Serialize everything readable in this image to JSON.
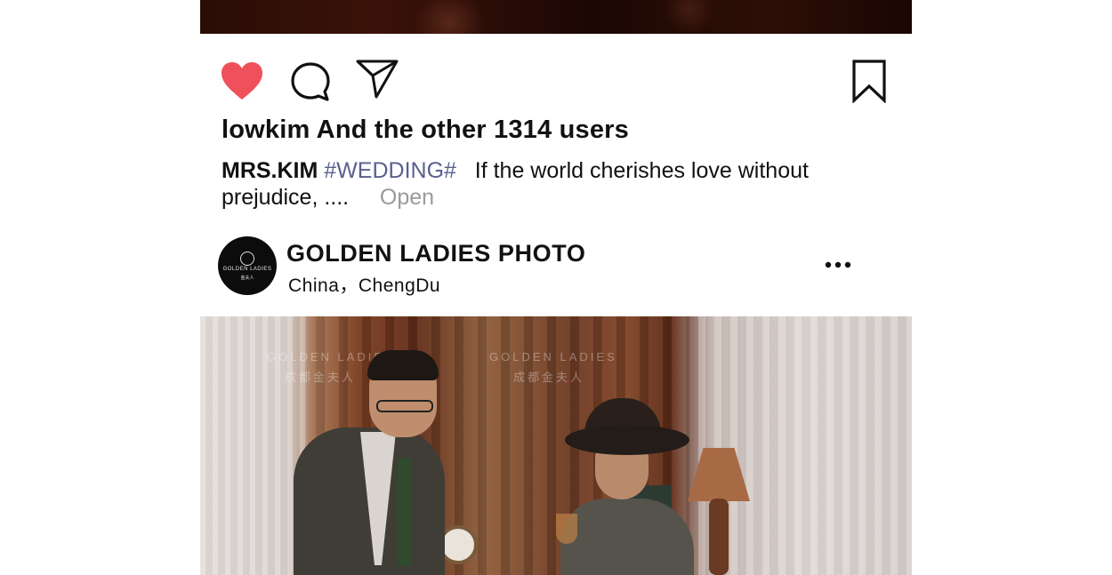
{
  "post": {
    "likes_text": "lowkim And the other 1314 users",
    "caption": {
      "author": "MRS.KIM",
      "hashtag": "#WEDDING#",
      "text": "If the world cherishes love without prejudice, ....",
      "open_label": "Open"
    },
    "icons": {
      "like": "heart-icon",
      "comment": "comment-icon",
      "share": "send-icon",
      "save": "bookmark-icon",
      "more": "more-icon"
    },
    "colors": {
      "liked_heart": "#f0505c",
      "hashtag": "#5a5f8e",
      "open_link": "#9a9a9a"
    }
  },
  "account": {
    "name": "GOLDEN LADIES PHOTO",
    "location": "China，ChengDu",
    "avatar_text": "GOLDEN LADIES",
    "avatar_subtext": "金夫人"
  },
  "photo": {
    "watermark": "GOLDEN LADIES",
    "watermark_sub": "成都金夫人"
  }
}
